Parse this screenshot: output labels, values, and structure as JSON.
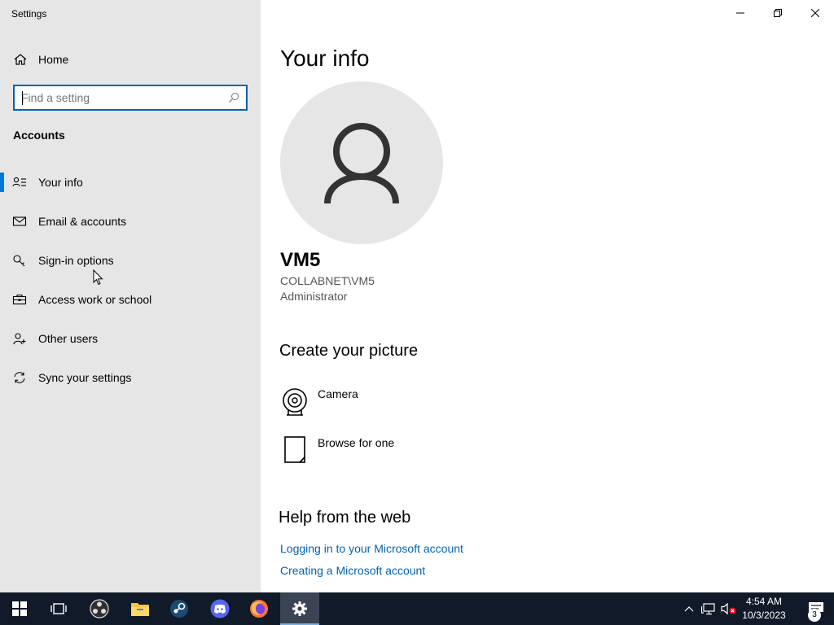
{
  "app": {
    "title": "Settings"
  },
  "sidebar": {
    "home_label": "Home",
    "search": {
      "placeholder": "Find a setting",
      "value": ""
    },
    "section_title": "Accounts",
    "items": [
      {
        "label": "Your info",
        "icon": "person-list-icon",
        "active": true
      },
      {
        "label": "Email & accounts",
        "icon": "mail-icon",
        "active": false
      },
      {
        "label": "Sign-in options",
        "icon": "key-icon",
        "active": false
      },
      {
        "label": "Access work or school",
        "icon": "briefcase-icon",
        "active": false
      },
      {
        "label": "Other users",
        "icon": "person-add-icon",
        "active": false
      },
      {
        "label": "Sync your settings",
        "icon": "sync-icon",
        "active": false
      }
    ]
  },
  "main": {
    "title": "Your info",
    "user": {
      "name": "VM5",
      "domain": "COLLABNET\\VM5",
      "role": "Administrator"
    },
    "create_picture": {
      "title": "Create your picture",
      "options": [
        {
          "label": "Camera",
          "icon": "camera-icon"
        },
        {
          "label": "Browse for one",
          "icon": "document-icon"
        }
      ]
    },
    "help": {
      "title": "Help from the web",
      "links": [
        "Logging in to your Microsoft account",
        "Creating a Microsoft account"
      ]
    }
  },
  "taskbar": {
    "apps": [
      "start",
      "task-view",
      "obs",
      "file-explorer",
      "steam",
      "discord",
      "firefox",
      "settings"
    ],
    "active_app": "settings",
    "clock": {
      "time": "4:54 AM",
      "date": "10/3/2023"
    },
    "notification_count": "3"
  },
  "colors": {
    "accent": "#0078d7",
    "link": "#0063b1",
    "sidebar_bg": "#e6e6e6",
    "taskbar_bg": "#101a28"
  }
}
